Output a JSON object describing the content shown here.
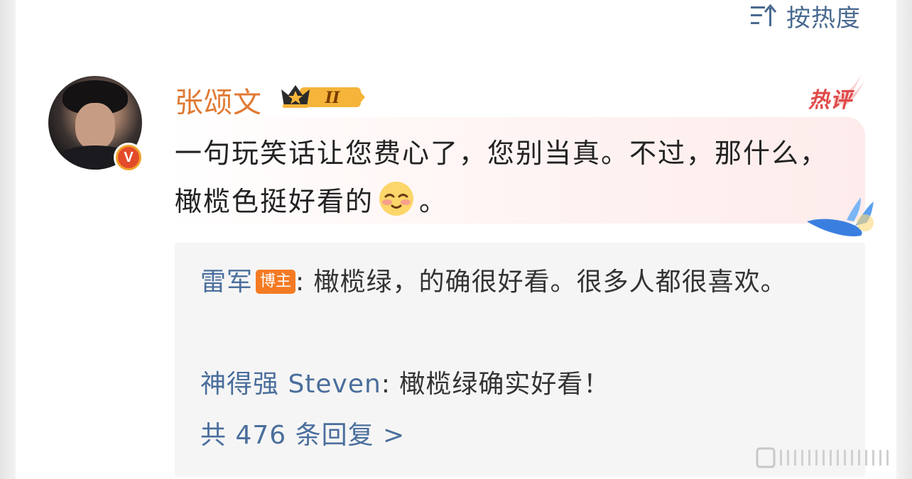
{
  "sort": {
    "label": "按热度",
    "icon": "sort-icon"
  },
  "comment": {
    "user": {
      "name": "张颂文",
      "verified_icon": "verified-v-badge",
      "level_text": "II"
    },
    "hot_label": "热评",
    "text_part1": "一句玩笑话让您费心了，您别当真。不过，那什么，橄榄色挺好看的",
    "emoji": "shy-smile-emoji",
    "text_part2": "。"
  },
  "replies": [
    {
      "name": "雷军",
      "badge": "博主",
      "sep": ": ",
      "text": "橄榄绿，的确很好看。很多人都很喜欢。"
    },
    {
      "name": "神得强 Steven",
      "sep": ": ",
      "text": "橄榄绿确实好看！"
    }
  ],
  "more_replies": "共 476 条回复 >",
  "colors": {
    "username": "#e07a34",
    "link": "#4a6e9c",
    "badge": "#f47a23",
    "hot": "#e04a4a"
  }
}
